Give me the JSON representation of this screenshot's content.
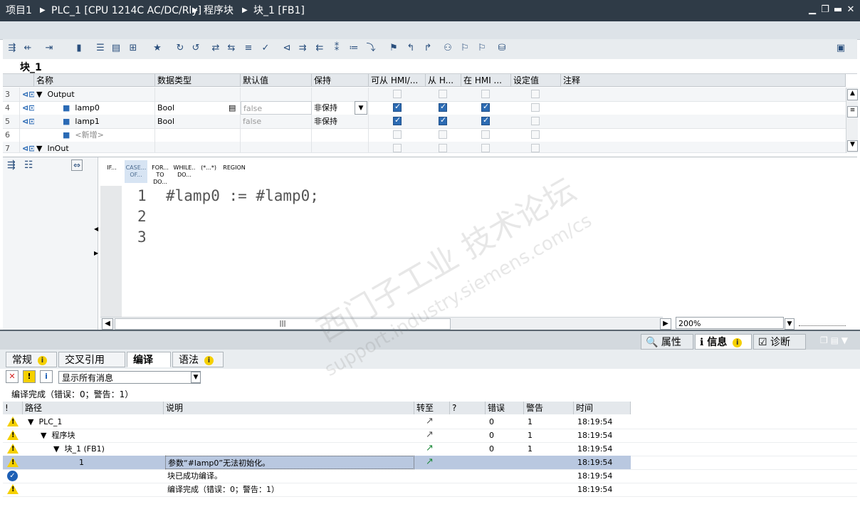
{
  "title": {
    "crumbs": [
      "项目1",
      "PLC_1 [CPU 1214C AC/DC/Rly]",
      "程序块",
      "块_1 [FB1]"
    ]
  },
  "block_name": "块_1",
  "interface": {
    "columns": [
      "名称",
      "数据类型",
      "默认值",
      "保持",
      "可从 HMI/...",
      "从 H...",
      "在 HMI ...",
      "设定值",
      "注释"
    ],
    "rows": [
      {
        "num": "3",
        "name": "Output",
        "type": "",
        "default": "",
        "retain": ""
      },
      {
        "num": "4",
        "name": "lamp0",
        "type": "Bool",
        "default": "false",
        "retain": "非保持"
      },
      {
        "num": "5",
        "name": "lamp1",
        "type": "Bool",
        "default": "false",
        "retain": "非保持"
      },
      {
        "num": "6",
        "name": "<新增>",
        "type": "",
        "default": "",
        "retain": ""
      },
      {
        "num": "7",
        "name": "InOut",
        "type": "",
        "default": "",
        "retain": ""
      }
    ]
  },
  "snippets": [
    {
      "l1": "IF...",
      "l2": ""
    },
    {
      "l1": "CASE...",
      "l2": "OF..."
    },
    {
      "l1": "FOR...",
      "l2": "TO DO..."
    },
    {
      "l1": "WHILE..",
      "l2": "DO..."
    },
    {
      "l1": "(*...*)",
      "l2": ""
    },
    {
      "l1": "REGION",
      "l2": ""
    }
  ],
  "code": {
    "line_numbers": [
      "1",
      "2",
      "3"
    ],
    "line1": "#lamp0 := #lamp0;"
  },
  "zoom": "200%",
  "panel_tabs": {
    "props": "属性",
    "info": "信息",
    "diag": "诊断"
  },
  "sub_tabs": [
    "常规",
    "交叉引用",
    "编译",
    "语法"
  ],
  "filter": "显示所有消息",
  "summary": "编译完成（错误：0；警告：1）",
  "msg_columns": [
    "!",
    "路径",
    "说明",
    "转至",
    "?",
    "错误",
    "警告",
    "时间"
  ],
  "messages": [
    {
      "path": "PLC_1",
      "desc": "",
      "err": "0",
      "warn": "1",
      "time": "18:19:54"
    },
    {
      "path": "程序块",
      "desc": "",
      "err": "0",
      "warn": "1",
      "time": "18:19:54"
    },
    {
      "path": "块_1 (FB1)",
      "desc": "",
      "err": "0",
      "warn": "1",
      "time": "18:19:54"
    },
    {
      "path": "1",
      "desc": "参数“#lamp0”无法初始化。",
      "err": "",
      "warn": "",
      "time": "18:19:54"
    },
    {
      "path": "",
      "desc": "块已成功编译。",
      "err": "",
      "warn": "",
      "time": "18:19:54"
    },
    {
      "path": "",
      "desc": "编译完成（错误：0；警告：1）",
      "err": "",
      "warn": "",
      "time": "18:19:54"
    }
  ],
  "watermark": {
    "line1": "西门子工业 技术论坛",
    "line2": "support.industry.siemens.com/cs"
  },
  "colors": {
    "titlebar": "#2f3b47",
    "selection": "#b9c8e0",
    "warning": "#f5d000",
    "checked": "#2c6bb3"
  }
}
